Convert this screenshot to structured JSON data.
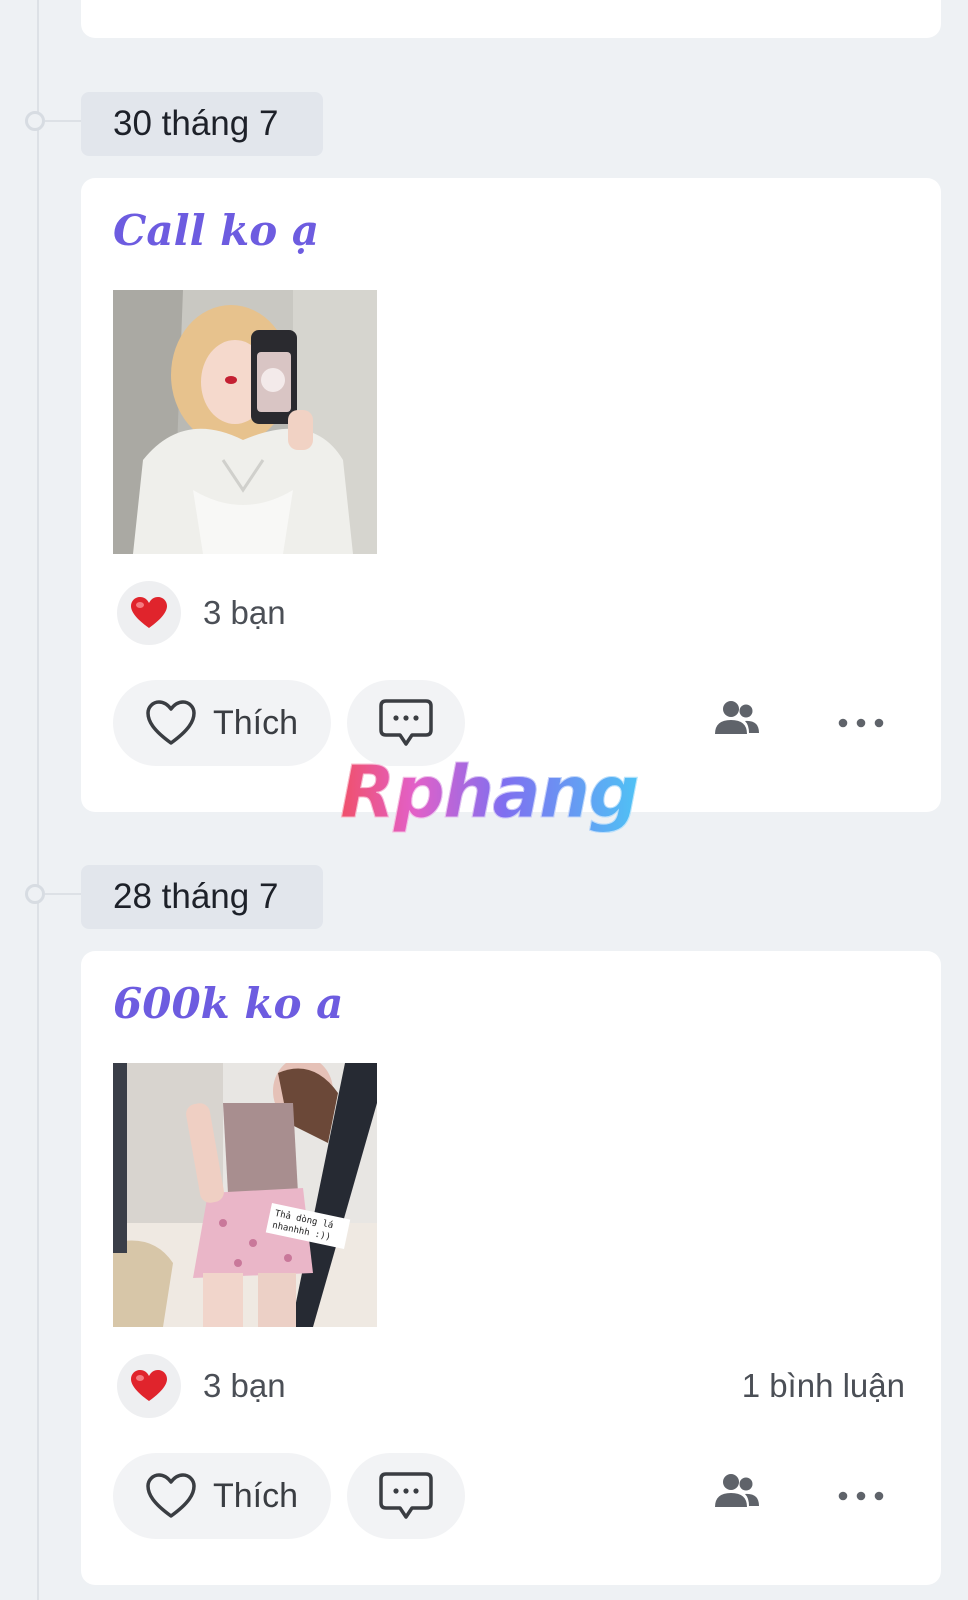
{
  "posts": [
    {
      "date": "30 tháng 7",
      "title": "Call ko ạ",
      "photo_icon": "photo-selfie-white-top",
      "reaction_icon": "heart-icon",
      "reaction_count": "3 bạn",
      "comment_count": "",
      "like_label": "Thích"
    },
    {
      "date": "28 tháng 7",
      "title": "600k ko a",
      "photo_icon": "photo-mirror-pink-shorts",
      "photo_caption": "Thả dòng lá nhanhhh :))",
      "reaction_icon": "heart-icon",
      "reaction_count": "3 bạn",
      "comment_count": "1 bình luận",
      "like_label": "Thích"
    }
  ],
  "watermark": "Rphang",
  "colors": {
    "background": "#eef1f4",
    "title_accent": "#6d5ce0",
    "heart": "#e0242c",
    "card": "#ffffff"
  }
}
